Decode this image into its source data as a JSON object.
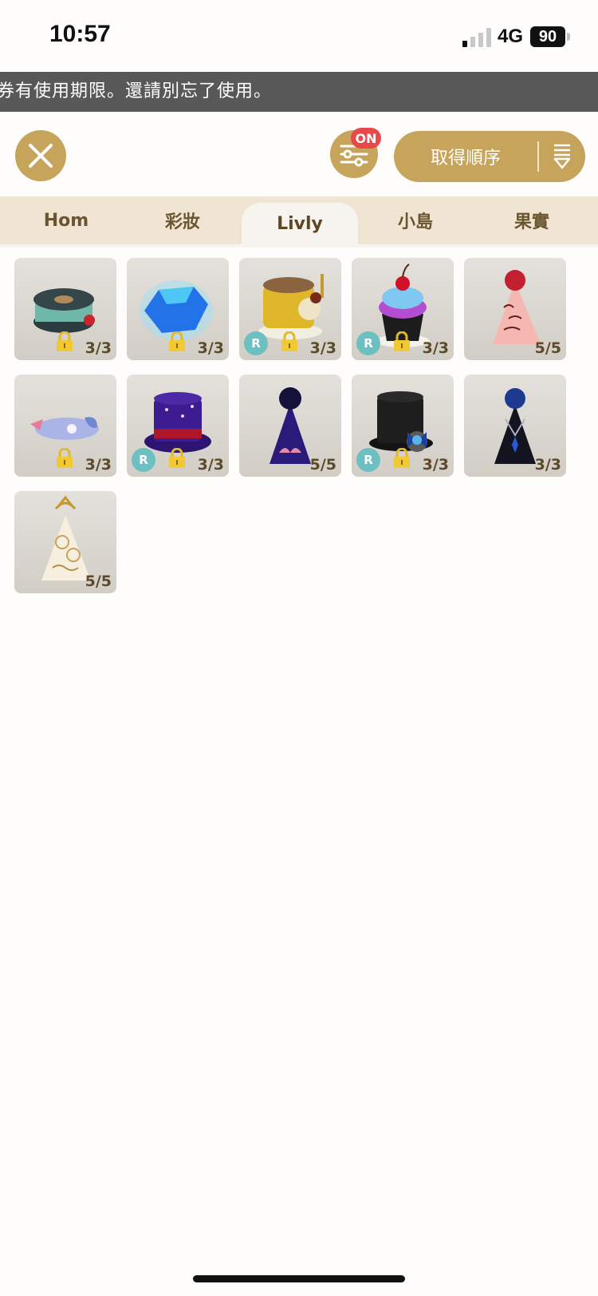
{
  "status": {
    "time": "10:57",
    "network": "4G",
    "battery": "90"
  },
  "banner": {
    "text": "券有使用期限。還請別忘了使用。"
  },
  "toolbar": {
    "close_icon": "close-icon",
    "filter_icon": "filter-sliders-icon",
    "filter_badge": "ON",
    "sort_label": "取得順序",
    "sort_icon": "sort-descending-icon",
    "accent_color": "#c6a45c",
    "badge_color": "#e8484a"
  },
  "tabs": [
    {
      "label": "Hom",
      "active": false
    },
    {
      "label": "彩妝",
      "active": false
    },
    {
      "label": "Livly",
      "active": true
    },
    {
      "label": "小島",
      "active": false
    },
    {
      "label": "果實",
      "active": false
    }
  ],
  "items": [
    {
      "name": "thread-spool",
      "count": "3/3",
      "locked": true,
      "rare": false
    },
    {
      "name": "blue-gem",
      "count": "3/3",
      "locked": true,
      "rare": false
    },
    {
      "name": "music-cup",
      "count": "3/3",
      "locked": true,
      "rare": true
    },
    {
      "name": "cupcake",
      "count": "3/3",
      "locked": true,
      "rare": true
    },
    {
      "name": "red-party-hat",
      "count": "5/5",
      "locked": false,
      "rare": false
    },
    {
      "name": "fish-ribbon",
      "count": "3/3",
      "locked": true,
      "rare": false
    },
    {
      "name": "purple-top-hat",
      "count": "3/3",
      "locked": true,
      "rare": true
    },
    {
      "name": "navy-party-hat",
      "count": "5/5",
      "locked": false,
      "rare": false
    },
    {
      "name": "black-top-hat",
      "count": "3/3",
      "locked": true,
      "rare": true
    },
    {
      "name": "black-party-hat",
      "count": "3/3",
      "locked": false,
      "rare": false
    },
    {
      "name": "cream-party-hat",
      "count": "5/5",
      "locked": false,
      "rare": false
    }
  ],
  "badges": {
    "rare_label": "R",
    "lock_icon": "lock-icon"
  }
}
